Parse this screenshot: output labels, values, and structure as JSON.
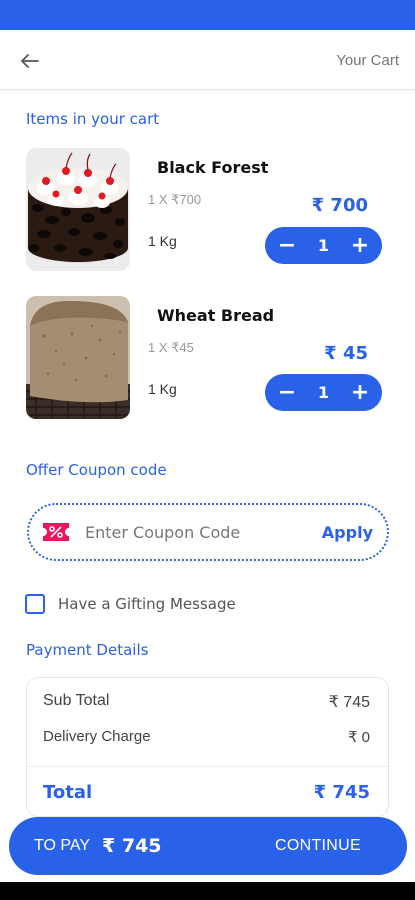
{
  "header": {
    "title": "Your Cart",
    "back_icon": "arrow-left-icon"
  },
  "cart": {
    "section_title": "Items in your cart",
    "items": [
      {
        "name": "Black Forest",
        "unit_price": "1 X ₹700",
        "weight": "1 Kg",
        "price": "₹ 700",
        "quantity": "1"
      },
      {
        "name": "Wheat Bread",
        "unit_price": "1 X ₹45",
        "weight": "1 Kg",
        "price": "₹ 45",
        "quantity": "1"
      }
    ]
  },
  "stepper": {
    "minus": "−",
    "plus": "+"
  },
  "coupon": {
    "section_title": "Offer Coupon code",
    "placeholder": "Enter Coupon Code",
    "apply_label": "Apply",
    "icon": "coupon-percent-icon"
  },
  "gift": {
    "label": "Have a Gifting Message",
    "checked": false
  },
  "payment": {
    "section_title": "Payment Details",
    "subtotal_label": "Sub Total",
    "subtotal_value": "₹ 745",
    "delivery_label": "Delivery Charge",
    "delivery_value": "₹ 0",
    "total_label": "Total",
    "total_value": "₹ 745"
  },
  "pay_bar": {
    "to_pay_label": "TO PAY",
    "to_pay_amount": "₹ 745",
    "continue_label": "CONTINUE"
  },
  "colors": {
    "accent": "#2962e8",
    "coupon_icon": "#e8175d"
  }
}
